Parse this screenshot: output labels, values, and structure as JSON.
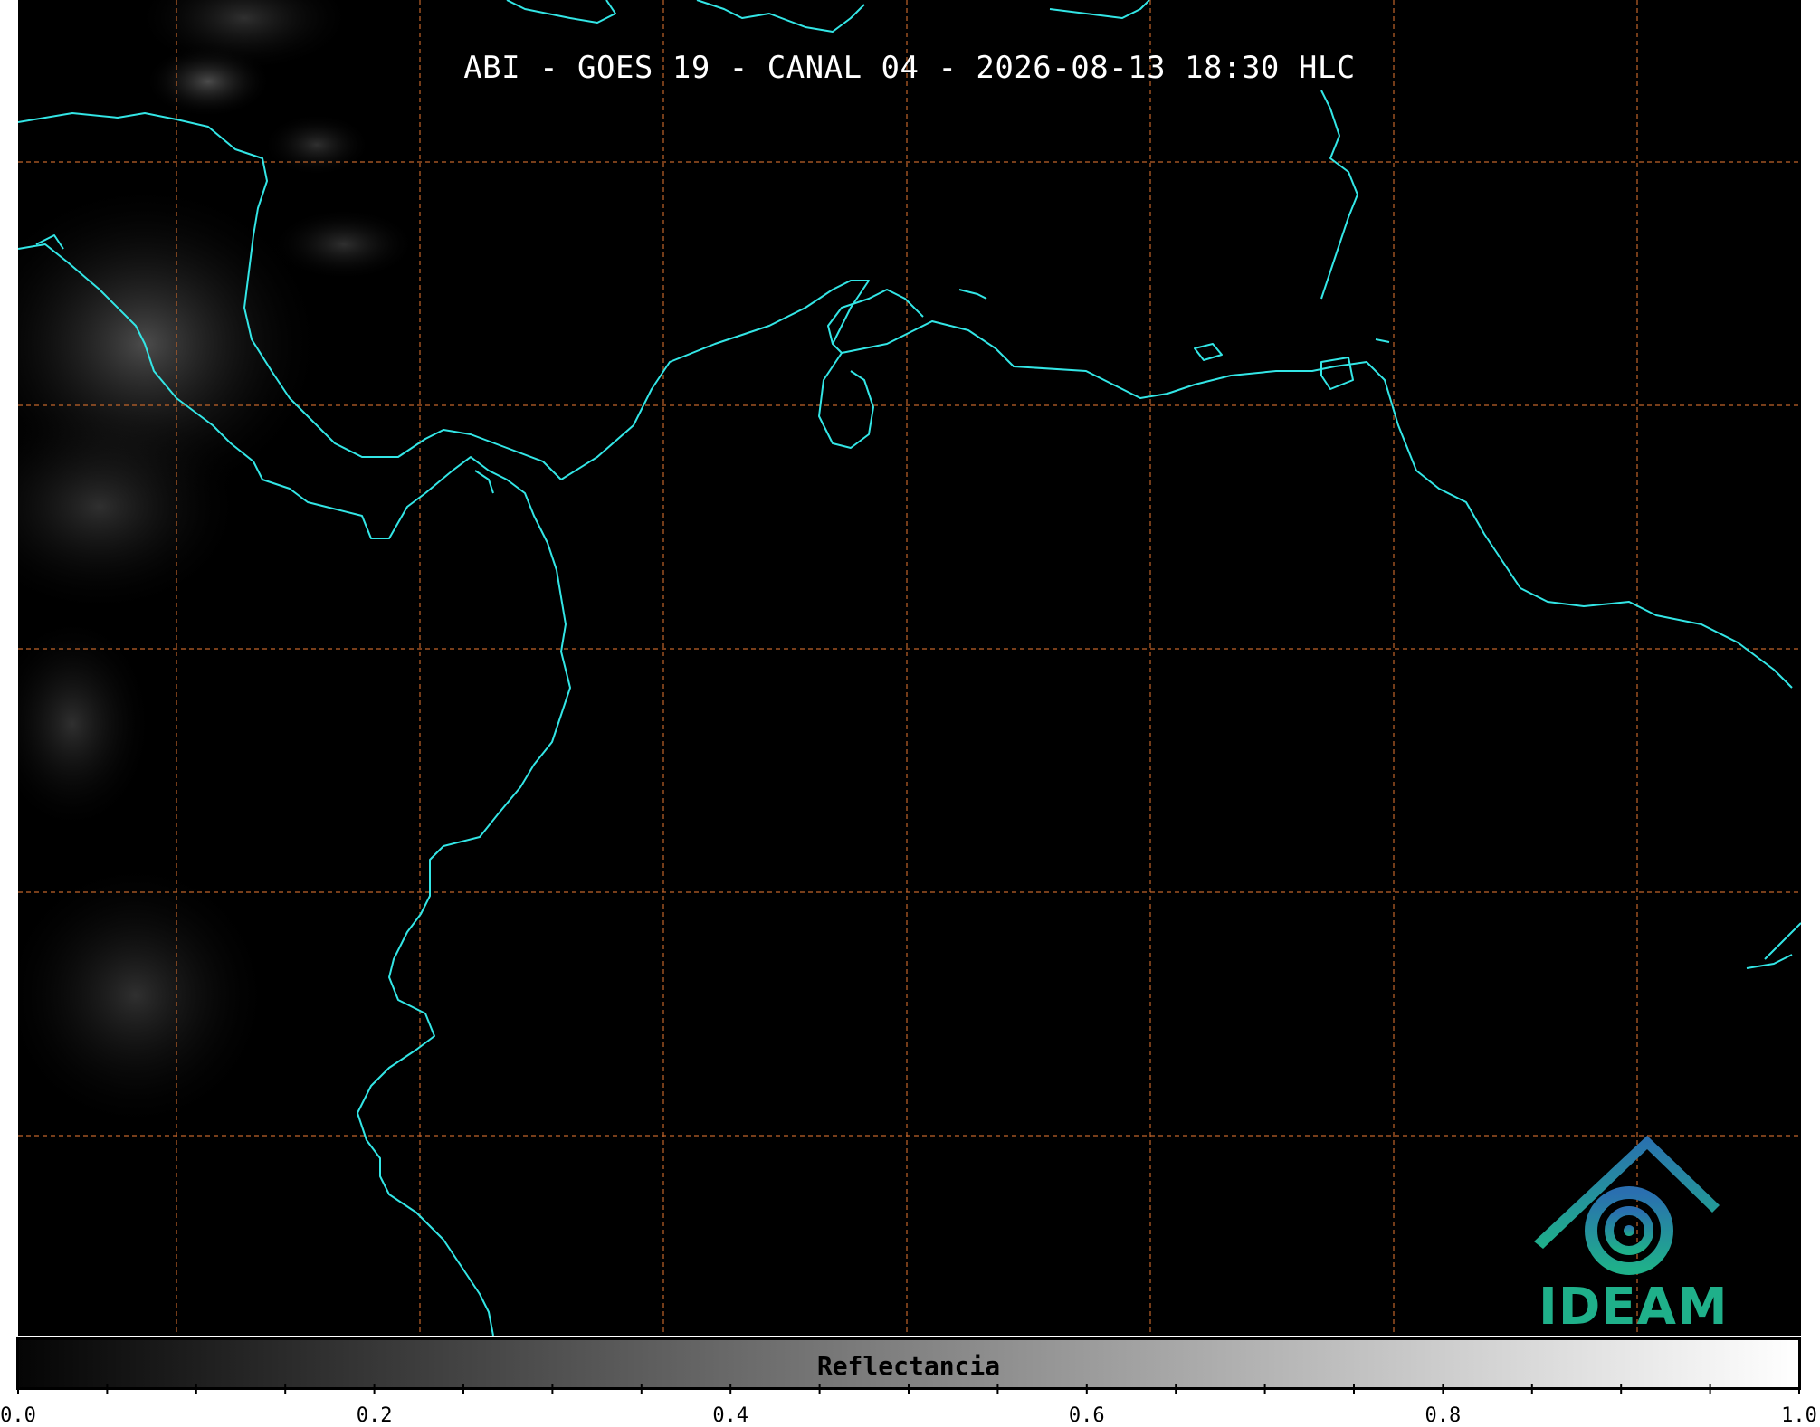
{
  "title": "ABI - GOES 19 - CANAL 04 - 2026-08-13 18:30 HLC",
  "colors": {
    "background": "#000000",
    "coastline": "#33e6e6",
    "gridlines": "#c0642a",
    "logo_gradient_start": "#2a6fb0",
    "logo_gradient_end": "#1fb08a"
  },
  "logo": {
    "icon": "ideam-logo-icon",
    "text": "IDEAM"
  },
  "colorbar": {
    "label": "Reflectancia",
    "range": [
      0.0,
      1.0
    ],
    "colormap": "grayscale",
    "tick_labels": [
      "0.0",
      "0.2",
      "0.4",
      "0.6",
      "0.8",
      "1.0"
    ],
    "major_ticks": [
      0.0,
      0.2,
      0.4,
      0.6,
      0.8,
      1.0
    ],
    "minor_tick_step": 0.05
  }
}
